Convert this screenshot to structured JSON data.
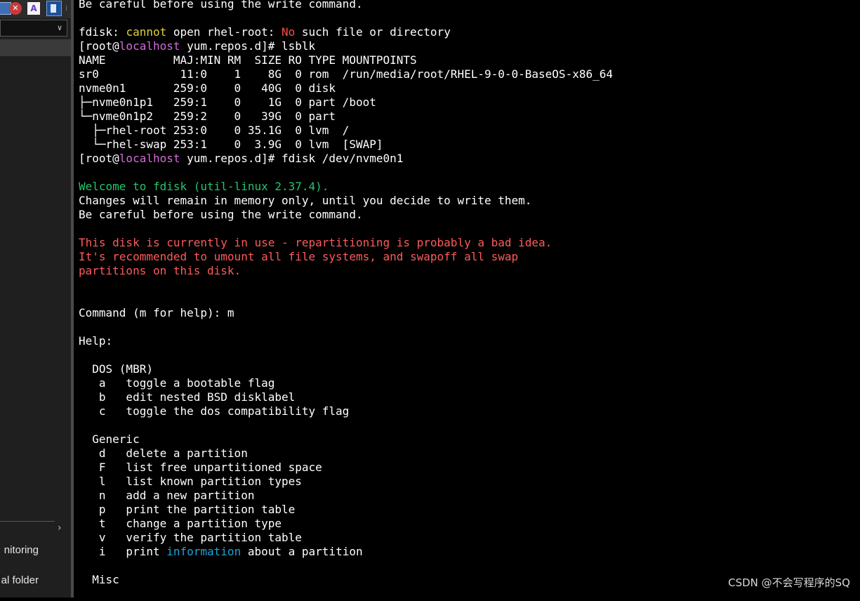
{
  "side_panel": {
    "close_icon_glyph": "✕",
    "font_icon_glyph": "A",
    "more_glyph": "⁞",
    "combo_chevron": "∨",
    "side_chevron": "›",
    "items": [
      "nitoring",
      "al folder"
    ]
  },
  "terminal": {
    "lines": [
      [
        {
          "t": "Be careful before using the write command."
        }
      ],
      [
        {
          "t": ""
        }
      ],
      [
        {
          "t": "fdisk: "
        },
        {
          "t": "cannot",
          "c": "yellow"
        },
        {
          "t": " open rhel-root: "
        },
        {
          "t": "No",
          "c": "red"
        },
        {
          "t": " such file or directory"
        }
      ],
      [
        {
          "t": "[root@"
        },
        {
          "t": "localhost",
          "c": "magenta"
        },
        {
          "t": " yum.repos.d]# lsblk"
        }
      ],
      [
        {
          "t": "NAME          MAJ:MIN RM  SIZE RO TYPE MOUNTPOINTS"
        }
      ],
      [
        {
          "t": "sr0            11:0    1    8G  0 rom  /run/media/root/RHEL-9-0-0-BaseOS-x86_64"
        }
      ],
      [
        {
          "t": "nvme0n1       259:0    0   40G  0 disk"
        }
      ],
      [
        {
          "t": "├─nvme0n1p1   259:1    0    1G  0 part /boot"
        }
      ],
      [
        {
          "t": "└─nvme0n1p2   259:2    0   39G  0 part"
        }
      ],
      [
        {
          "t": "  ├─rhel-root 253:0    0 35.1G  0 lvm  /"
        }
      ],
      [
        {
          "t": "  └─rhel-swap 253:1    0  3.9G  0 lvm  [SWAP]"
        }
      ],
      [
        {
          "t": "[root@"
        },
        {
          "t": "localhost",
          "c": "magenta"
        },
        {
          "t": " yum.repos.d]# fdisk /dev/nvme0n1"
        }
      ],
      [
        {
          "t": ""
        }
      ],
      [
        {
          "t": "Welcome to fdisk (util-linux 2.37.4).",
          "c": "green"
        }
      ],
      [
        {
          "t": "Changes will remain in memory only, until you decide to write them."
        }
      ],
      [
        {
          "t": "Be careful before using the write command."
        }
      ],
      [
        {
          "t": ""
        }
      ],
      [
        {
          "t": "This disk is currently in use - repartitioning is probably a bad idea.",
          "c": "salmon"
        }
      ],
      [
        {
          "t": "It's recommended to umount all file systems, and swapoff all swap",
          "c": "salmon"
        }
      ],
      [
        {
          "t": "partitions on this disk.",
          "c": "salmon"
        }
      ],
      [
        {
          "t": ""
        }
      ],
      [
        {
          "t": ""
        }
      ],
      [
        {
          "t": "Command (m for help): m"
        }
      ],
      [
        {
          "t": ""
        }
      ],
      [
        {
          "t": "Help:"
        }
      ],
      [
        {
          "t": ""
        }
      ],
      [
        {
          "t": "  DOS (MBR)"
        }
      ],
      [
        {
          "t": "   a   toggle a bootable flag"
        }
      ],
      [
        {
          "t": "   b   edit nested BSD disklabel"
        }
      ],
      [
        {
          "t": "   c   toggle the dos compatibility flag"
        }
      ],
      [
        {
          "t": ""
        }
      ],
      [
        {
          "t": "  Generic"
        }
      ],
      [
        {
          "t": "   d   delete a partition"
        }
      ],
      [
        {
          "t": "   F   list free unpartitioned space"
        }
      ],
      [
        {
          "t": "   l   list known partition types"
        }
      ],
      [
        {
          "t": "   n   add a new partition"
        }
      ],
      [
        {
          "t": "   p   print the partition table"
        }
      ],
      [
        {
          "t": "   t   change a partition type"
        }
      ],
      [
        {
          "t": "   v   verify the partition table"
        }
      ],
      [
        {
          "t": "   i   print "
        },
        {
          "t": "information",
          "c": "cyan"
        },
        {
          "t": " about a partition"
        }
      ],
      [
        {
          "t": ""
        }
      ],
      [
        {
          "t": "  Misc"
        }
      ]
    ]
  },
  "watermark": "CSDN @不会写程序的SQ"
}
